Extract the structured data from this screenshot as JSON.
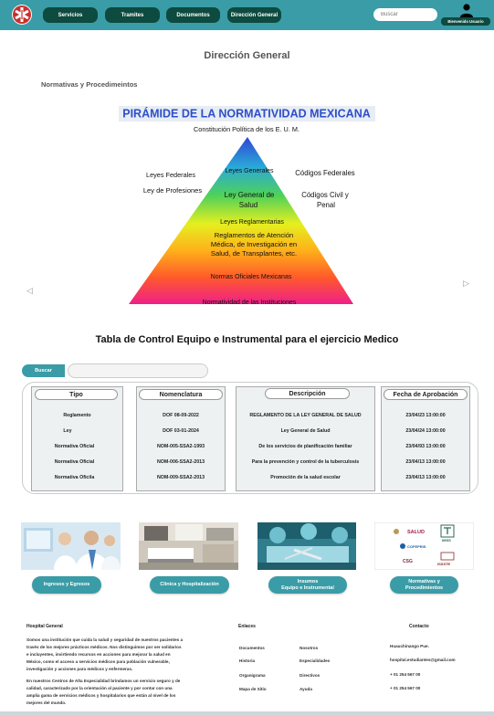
{
  "header": {
    "nav": [
      "Servicios",
      "Tramites",
      "Documentos",
      "Dirección General"
    ],
    "search_placeholder": "Buscar",
    "user_label": "Bienvenido Usuario"
  },
  "page": {
    "title": "Dirección General",
    "section": "Normativas y Procedimeintos"
  },
  "pyramid": {
    "title": "PIRÁMIDE DE LA NORMATIVIDAD MEXICANA",
    "top": "Constitución Política de los E. U. M.",
    "left1": "Leyes Federales",
    "left2": "Ley de Profesiones",
    "right1": "Códigos Federales",
    "right2a": "Códigos Civil y",
    "right2b": "Penal",
    "lvl1": "Leyes Generales",
    "lvl2a": "Ley General de",
    "lvl2b": "Salud",
    "lvl3": "Leyes Reglamentarias",
    "lvl4a": "Reglamentos de Atención",
    "lvl4b": "Médica, de Investigación en",
    "lvl4c": "Salud, de Transplantes, etc.",
    "lvl5": "Normas Oficiales Mexicanas",
    "lvl6": "Normatividad de las Instituciones"
  },
  "carousel": {
    "prev": "◁",
    "next": "▷"
  },
  "table": {
    "title": "Tabla de Control Equipo e Instrumental para el ejercicio Medico",
    "search_button": "Buscar",
    "headers": [
      "Tipo",
      "Nomenclatura",
      "Descripción",
      "Fecha de Aprobación"
    ],
    "rows": [
      [
        "Reglamento",
        "DOF 08-09-2022",
        "REGLAMENTO DE LA LEY GENERAL DE SALUD",
        "23/04/23 13:00:00"
      ],
      [
        "Ley",
        "DOF 03-01-2024",
        "Ley General de Salud",
        "23/04/24 13:00:00"
      ],
      [
        "Normativa Oficial",
        "NOM-005-SSA2-1993",
        "De los servicios de planificación familiar",
        "23/04/93 13:00:00"
      ],
      [
        "Normativa Oficial",
        "NOM-006-SSA2-2013",
        "Para la prevención y control de la tuberculosis",
        "23/04/13 13:00:00"
      ],
      [
        "Normativa Oficila",
        "NOM-009-SSA2-2013",
        "Promoción de la salud escolar",
        "23/04/13 13:00:00"
      ]
    ]
  },
  "cards": [
    {
      "label1": "Ingresos y Egresos",
      "label2": ""
    },
    {
      "label1": "Clinica y Hospitalización",
      "label2": ""
    },
    {
      "label1": "Insumos",
      "label2": "Equipo e Instrumental"
    },
    {
      "label1": "Normativas y",
      "label2": "Procedimientos"
    }
  ],
  "logos": {
    "salud": "SALUD",
    "imss": "IMSS",
    "cofepris": "COFEPRIS",
    "csg": "CSG",
    "issste": "ISSSTE"
  },
  "footer": {
    "col1_title": "Hospital General",
    "p1": [
      "Somos una institución que cuida la salud y seguridad de nuestros pacientes a",
      "través de los mejores prácticos médicos. Nos distinguimos por ser solidarios",
      "e incluyentes, invirtiendo recursos en acciones para mejorar la salud en",
      "México, como el acceso a servicios médicos para población vulnerable,",
      " investigación y acciones para médicos y enfermeras."
    ],
    "p2": [
      "En nuestros Centros de Alta Especialidad brindamos un servicio seguro y de",
      "calidad, caracterizado por la orientación al paciente y por contar con una",
      "amplia gama de servicios médicos y hospitalarios que están al nivel de los",
      " mejores del mundo."
    ],
    "col2_title": "Enlaces",
    "links_a": [
      "Documentos",
      "Historia",
      "Organigrama",
      "Mapa de Sitio"
    ],
    "links_b": [
      "Nosotros",
      "Especialidades",
      "Directivos",
      "Ayuda"
    ],
    "col3_title": "Contacto",
    "contact": [
      "Huauchinango Pue.",
      "hospital.estudiantes@gmail.com",
      "+ 01 254 567 00",
      "+ 01 254 567 00"
    ]
  },
  "colors": {
    "teal": "#3a9ca6",
    "dark_green": "#0d4a3f"
  }
}
